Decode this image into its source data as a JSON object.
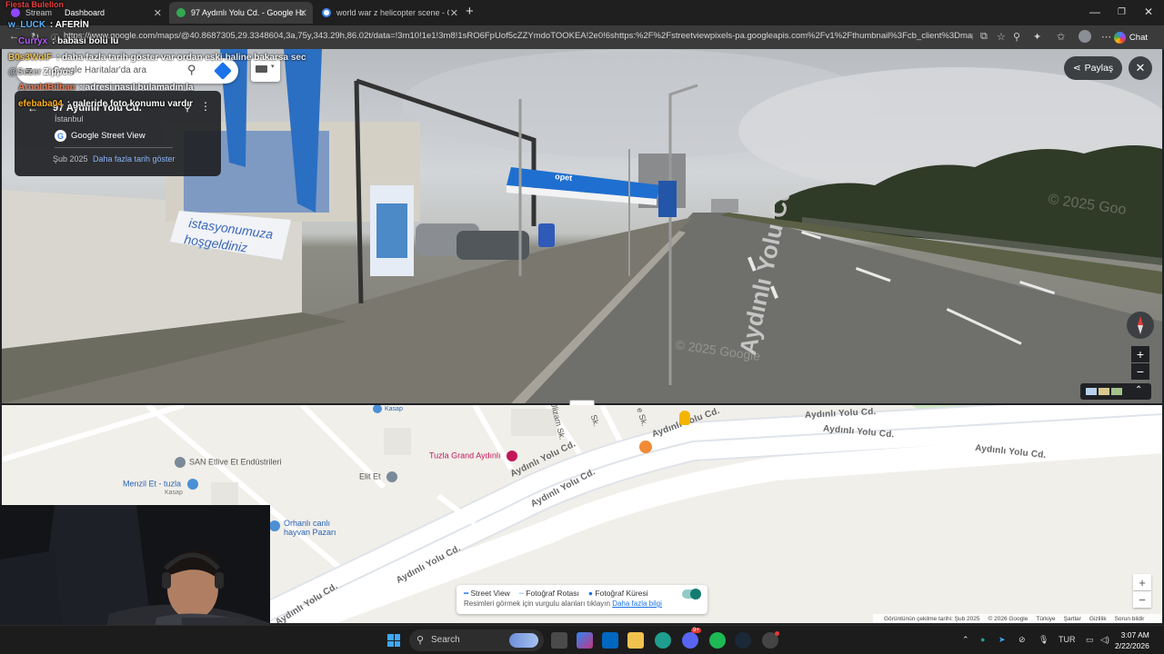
{
  "tabs": [
    {
      "label": "Stream",
      "overlay_label": "Fiesta Bulelion"
    },
    {
      "label": "Dashboard"
    },
    {
      "label": "97 Aydınlı Yolu Cd. - Google Harit"
    },
    {
      "label": "world war z helicopter scene - Goo"
    }
  ],
  "new_tab_symbol": "+",
  "address_bar": {
    "url": "https://www.google.com/maps/@40.8687305,29.3348604,3a,75y,343.29h,86.02t/data=!3m10!1e1!3m8!1sRO6FpUof5cZZYmdoTOOKEA!2e0!6shttps:%2F%2Fstreetviewpixels-pa.googleapis.com%2Fv1%2Fthumbnail%3Fcb_client%3Dmaps_sv.ta...",
    "chat_label": "Chat"
  },
  "chat_messages": [
    {
      "user": "w_LUCK",
      "message": "AFERİN",
      "color": "#5ab4ff"
    },
    {
      "user": "Curryx",
      "message": "babası bolu lu",
      "color": "#b65cff"
    },
    {
      "user": "B0s3WoIF",
      "message": "daha fazla tarih göster var ordan eski haline bakarsa sec",
      "color": "#f5c542"
    },
    {
      "user": "@Sezer",
      "message": "Zippos",
      "color": "#bdbdbd"
    },
    {
      "user": "ArnoldBilban",
      "message": "adresi nasıl bulamadın la",
      "color": "#e8734a"
    },
    {
      "user": "efebaba04",
      "message": "galeride foto konumu vardır",
      "color": "#ffb020"
    }
  ],
  "search": {
    "placeholder": "Google Haritalar'da ara"
  },
  "info_card": {
    "address": "97 Aydınlı Yolu Cd.",
    "city": "İstanbul",
    "source": "Google Street View",
    "date": "Şub 2025",
    "more_dates": "Daha fazla tarih göster"
  },
  "street_view": {
    "share_label": "Paylaş",
    "close_symbol": "✕",
    "road_marking": "Aydınlı Yolu Cd.",
    "watermark_1": "© 2025 Google",
    "watermark_2": "© 2025 Goo",
    "banner_text_1": "istasyonumuza",
    "banner_text_2": "hoşgeldiniz",
    "station_brand": "opet",
    "zoom_in": "+",
    "zoom_out": "−"
  },
  "map": {
    "pois": [
      {
        "label": "SAN Etlive Et Endüstrileri"
      },
      {
        "label": "Menzil Et - tuzla",
        "sub": "Kasap"
      },
      {
        "label": "Tuzla Grand Aydınlı",
        "color": "#c2185b"
      },
      {
        "label": "Elit Et"
      },
      {
        "label": "Kasap"
      },
      {
        "label": "Orhanlı canlı",
        "sub": "hayvan Pazarı"
      }
    ],
    "road_labels": [
      "Aydınlı Yolu Cd.",
      "Aydınlı Yolu Cd.",
      "Aydınlı Yolu Cd.",
      "Aydınlı Yolu Cd.",
      "Aydınlı Yolu Cd.",
      "Aydınlı Yolu Cd.",
      "Aydınlı Yolu Cd.",
      "Aydınlı Yolu Cd."
    ],
    "street_labels": [
      "Ulizam Sk.",
      "Sk.",
      "e Sk."
    ],
    "legend": {
      "items": [
        "Street View",
        "Fotoğraf Rotası",
        "Fotoğraf Küresi"
      ],
      "hint": "Resimleri görmek için vurgulu alanları tıklayın",
      "link": "Daha fazla bilgi",
      "toggle_on": true
    },
    "zoom_in": "+",
    "zoom_out": "−",
    "footer": [
      "Görüntünün çekilme tarihi: Şub 2025",
      "© 2026 Google",
      "Türkiye",
      "Şartlar",
      "Gizlilik",
      "Sorun bildir"
    ]
  },
  "taskbar": {
    "search_label": "Search",
    "language": "TUR",
    "time": "3:07 AM",
    "date": "2/22/2026",
    "discord_badge": "9+"
  }
}
